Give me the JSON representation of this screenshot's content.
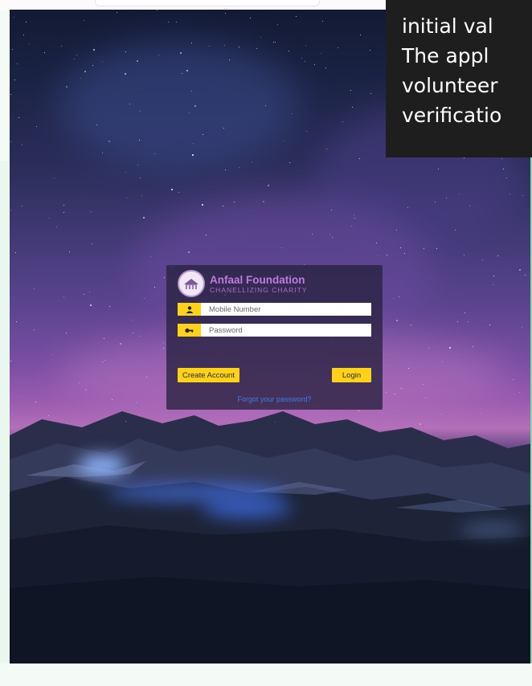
{
  "slide": {
    "lines": [
      "initial val",
      "The appl",
      "volunteer",
      "verificatio"
    ]
  },
  "login": {
    "brand_title": "Anfaal Foundation",
    "brand_subtitle": "CHANELLIZING CHARITY",
    "mobile_placeholder": "Mobile Number",
    "password_placeholder": "Password",
    "create_account_label": "Create Account",
    "login_label": "Login",
    "forgot_label": "Forgot your password?"
  },
  "icons": {
    "mobile_field": "user-icon",
    "password_field": "key-icon",
    "brand": "foundation-logo-icon"
  },
  "colors": {
    "accent_yellow": "#ffd21a",
    "brand_purple": "#c07ae0",
    "link_blue": "#3f7be6",
    "panel_bg": "#282240"
  }
}
